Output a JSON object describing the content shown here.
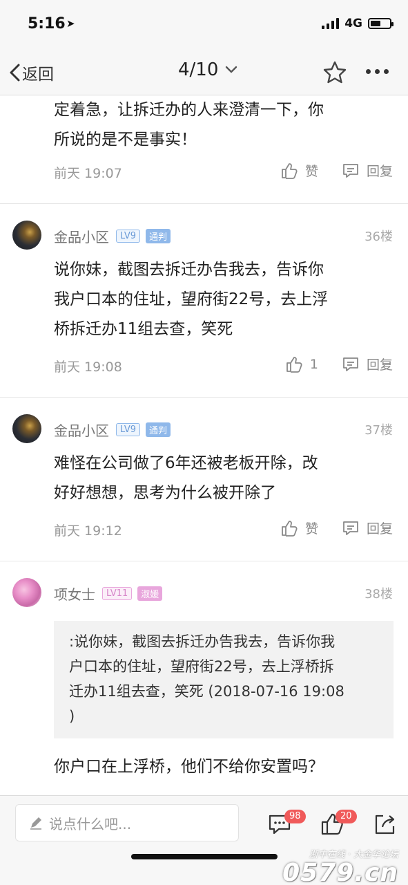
{
  "status_bar": {
    "time": "5:16",
    "network": "4G"
  },
  "nav": {
    "back_label": "返回",
    "page_indicator": "4/10"
  },
  "posts": [
    {
      "text_lines": [
        "定着急，让拆迁办的人来澄清一下，你",
        "所说的是不是事实！"
      ],
      "time": "前天 19:07",
      "like_label": "赞",
      "reply_label": "回复"
    },
    {
      "username": "金品小区",
      "level": "LV9",
      "badge": "通判",
      "floor": "36楼",
      "text_lines": [
        "说你妹，截图去拆迁办告我去，告诉你",
        "我户口本的住址，望府街22号，去上浮",
        "桥拆迁办11组去查，笑死"
      ],
      "time": "前天 19:08",
      "like_label": "1",
      "reply_label": "回复"
    },
    {
      "username": "金品小区",
      "level": "LV9",
      "badge": "通判",
      "floor": "37楼",
      "text_lines": [
        "难怪在公司做了6年还被老板开除，改",
        "好好想想，思考为什么被开除了"
      ],
      "time": "前天 19:12",
      "like_label": "赞",
      "reply_label": "回复"
    },
    {
      "username": "项女士",
      "level": "LV11",
      "badge": "淑媛",
      "floor": "38楼",
      "quote_lines": [
        ":说你妹，截图去拆迁办告我去，告诉你我",
        "户口本的住址，望府街22号，去上浮桥拆",
        "迁办11组去查，笑死 (2018-07-16 19:08",
        ")"
      ],
      "text_lines": [
        "你户口在上浮桥，他们不给你安置吗？"
      ]
    }
  ],
  "bottom_bar": {
    "placeholder": "说点什么吧...",
    "comment_count": "98",
    "like_count": "20"
  },
  "watermark": {
    "small": "浙中在线 · 大金华论坛",
    "big": "0579.cn"
  }
}
